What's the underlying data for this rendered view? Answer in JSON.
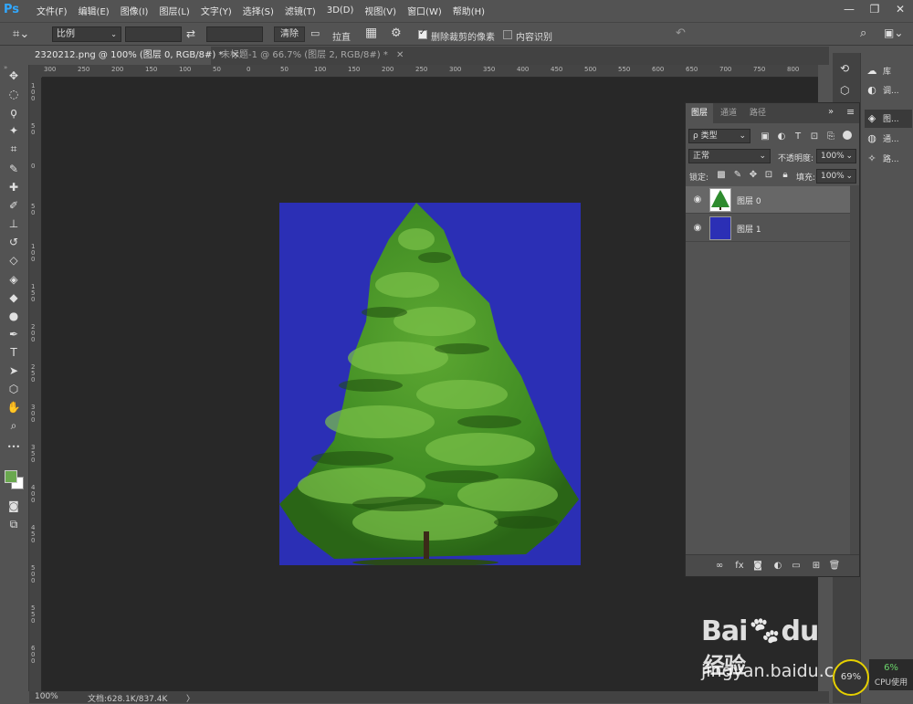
{
  "app": {
    "logo": "Ps",
    "menu": [
      "文件(F)",
      "编辑(E)",
      "图像(I)",
      "图层(L)",
      "文字(Y)",
      "选择(S)",
      "滤镜(T)",
      "3D(D)",
      "视图(V)",
      "窗口(W)",
      "帮助(H)"
    ],
    "window_controls": {
      "minimize": "—",
      "restore": "❐",
      "close": "✕"
    }
  },
  "options": {
    "ratio_select": "比例",
    "clear_button": "清除",
    "straighten_label": "拉直",
    "delete_cropped_label": "删除裁剪的像素",
    "delete_cropped_checked": true,
    "content_aware_label": "内容识别",
    "content_aware_checked": false
  },
  "tabs": [
    {
      "label": "2320212.png @ 100% (图层 0, RGB/8#) *",
      "active": true
    },
    {
      "label": "未标题-1 @ 66.7% (图层 2, RGB/8#) *",
      "active": false
    }
  ],
  "ruler": {
    "h_ticks": [
      "300",
      "250",
      "200",
      "150",
      "100",
      "50",
      "0",
      "50",
      "100",
      "150",
      "200",
      "250",
      "300",
      "350",
      "400",
      "450",
      "500",
      "550",
      "600",
      "650",
      "700",
      "750",
      "800"
    ],
    "v_ticks": [
      "1 0 0",
      "5 0",
      "0",
      "5 0",
      "1 0 0",
      "1 5 0",
      "2 0 0",
      "2 5 0",
      "3 0 0",
      "3 5 0",
      "4 0 0",
      "4 5 0",
      "5 0 0",
      "5 5 0",
      "6 0 0"
    ]
  },
  "toolbar": {
    "tools": [
      {
        "name": "move-tool-icon",
        "glyph": "✥"
      },
      {
        "name": "marquee-tool-icon",
        "glyph": "◌"
      },
      {
        "name": "lasso-tool-icon",
        "glyph": "ϙ"
      },
      {
        "name": "magic-wand-tool-icon",
        "glyph": "✦"
      },
      {
        "name": "crop-tool-icon",
        "glyph": "⌗"
      },
      {
        "name": "eyedropper-tool-icon",
        "glyph": "✎"
      },
      {
        "name": "healing-brush-tool-icon",
        "glyph": "✚"
      },
      {
        "name": "brush-tool-icon",
        "glyph": "✐"
      },
      {
        "name": "clone-stamp-tool-icon",
        "glyph": "⊥"
      },
      {
        "name": "history-brush-tool-icon",
        "glyph": "↺"
      },
      {
        "name": "eraser-tool-icon",
        "glyph": "◇"
      },
      {
        "name": "paint-bucket-tool-icon",
        "glyph": "◈"
      },
      {
        "name": "blur-tool-icon",
        "glyph": "◆"
      },
      {
        "name": "dodge-tool-icon",
        "glyph": "●"
      },
      {
        "name": "pen-tool-icon",
        "glyph": "✒"
      },
      {
        "name": "type-tool-icon",
        "glyph": "T"
      },
      {
        "name": "path-selection-tool-icon",
        "glyph": "➤"
      },
      {
        "name": "shape-tool-icon",
        "glyph": "⬡"
      },
      {
        "name": "hand-tool-icon",
        "glyph": "✋"
      },
      {
        "name": "zoom-tool-icon",
        "glyph": "⌕"
      },
      {
        "name": "more-tools-icon",
        "glyph": "•••"
      }
    ],
    "foreground_color": "#6aa84f",
    "background_color": "#ffffff"
  },
  "status": {
    "zoom": "100%",
    "doc_info": "文档:628.1K/837.4K",
    "arrow": "〉"
  },
  "dock": {
    "items": [
      {
        "icon": "libraries-icon",
        "glyph": "☁",
        "label": "库"
      },
      {
        "icon": "adjustments-icon",
        "glyph": "◐",
        "label": "调..."
      },
      {
        "icon": "layers-icon",
        "glyph": "◈",
        "label": "图..."
      },
      {
        "icon": "channels-icon",
        "glyph": "◍",
        "label": "通..."
      },
      {
        "icon": "paths-icon",
        "glyph": "✧",
        "label": "路..."
      }
    ]
  },
  "layers_panel": {
    "tabs": [
      "图层",
      "通道",
      "路径"
    ],
    "filter_label": "ρ 类型",
    "blend_mode": "正常",
    "opacity_label": "不透明度:",
    "opacity_value": "100%",
    "lock_label": "锁定:",
    "fill_label": "填充:",
    "fill_value": "100%",
    "layers": [
      {
        "name": "图层 0",
        "selected": true,
        "thumb_color": "#2e8b2e"
      },
      {
        "name": "图层 1",
        "selected": false,
        "thumb_color": "#2b2fb5"
      }
    ],
    "footer_icons": [
      "link-layers-icon",
      "fx-icon",
      "add-mask-icon",
      "adjustment-layer-icon",
      "group-icon",
      "new-layer-icon",
      "delete-layer-icon"
    ]
  },
  "artboard": {
    "background_color": "#2b2fb5"
  },
  "watermark": {
    "logo": "Bai",
    "logo2": "du",
    "cn": "经验",
    "url": "jingyan.baidu.com"
  },
  "cpu": {
    "ring": "69%",
    "percent": "6%",
    "label": "CPU使用"
  }
}
